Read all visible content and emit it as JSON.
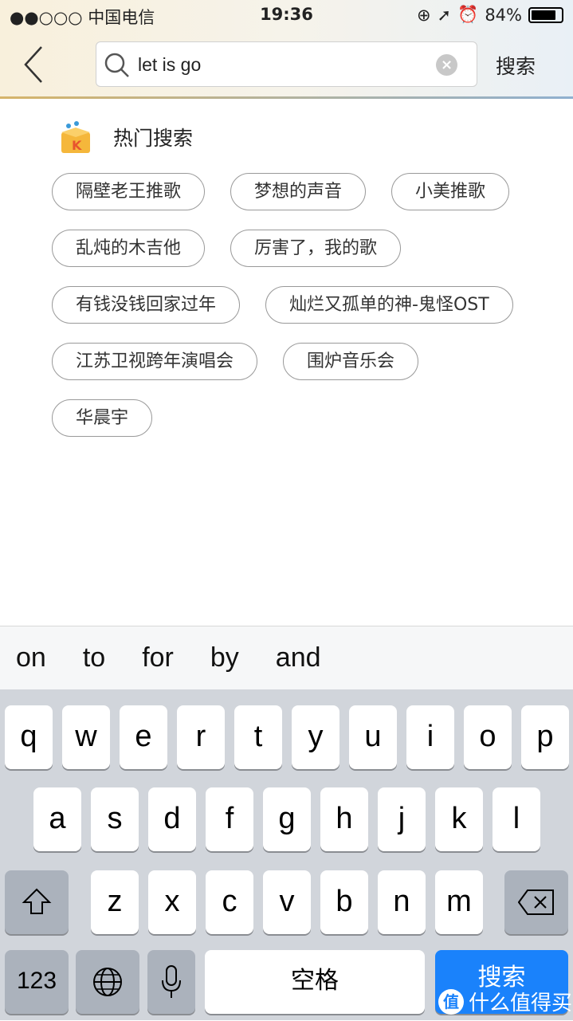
{
  "status": {
    "carrier": "●●○○○ 中国电信",
    "time": "19:36",
    "battery": "84%",
    "battery_level": 0.84
  },
  "header": {
    "search_value": "let is go",
    "search_button": "搜索"
  },
  "hot": {
    "title": "热门搜索",
    "items": [
      "隔壁老王推歌",
      "梦想的声音",
      "小美推歌",
      "乱炖的木吉他",
      "厉害了，我的歌",
      "有钱没钱回家过年",
      "灿烂又孤单的神-鬼怪OST",
      "江苏卫视跨年演唱会",
      "围炉音乐会",
      "华晨宇"
    ]
  },
  "suggestions": [
    "on",
    "to",
    "for",
    "by",
    "and"
  ],
  "keyboard": {
    "row1": [
      "q",
      "w",
      "e",
      "r",
      "t",
      "y",
      "u",
      "i",
      "o",
      "p"
    ],
    "row2": [
      "a",
      "s",
      "d",
      "f",
      "g",
      "h",
      "j",
      "k",
      "l"
    ],
    "row3": [
      "z",
      "x",
      "c",
      "v",
      "b",
      "n",
      "m"
    ],
    "numbers": "123",
    "space": "空格",
    "search": "搜索"
  },
  "watermark": {
    "badge": "值",
    "text": "什么值得买"
  },
  "colors": {
    "accent": "#1a82fb",
    "keyboard_bg": "#d1d5db"
  }
}
